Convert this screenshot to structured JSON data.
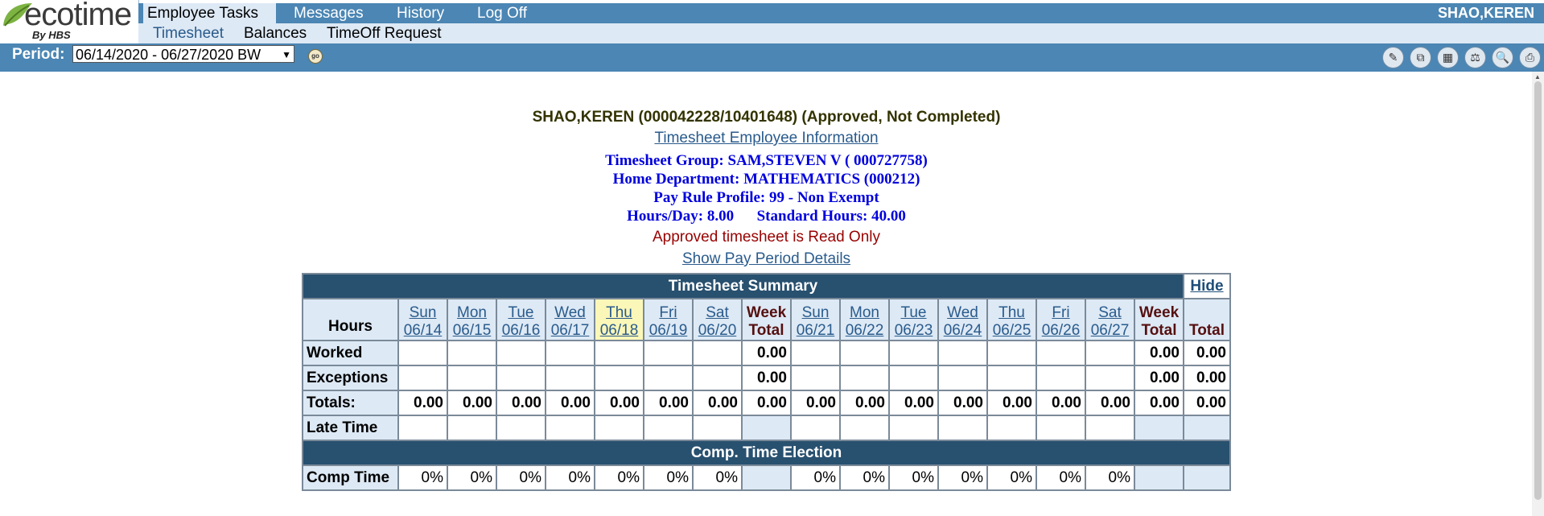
{
  "app": {
    "brand": "ecotime",
    "brand_sub": "By HBS",
    "user": "SHAO,KEREN"
  },
  "topnav": [
    "Employee Tasks",
    "Messages",
    "History",
    "Log Off"
  ],
  "subnav": [
    "Timesheet",
    "Balances",
    "TimeOff Request"
  ],
  "period": {
    "label": "Period:",
    "selected": "06/14/2020 - 06/27/2020 BW",
    "go_label": "go"
  },
  "employee": {
    "title": "SHAO,KEREN (000042228/10401648) (Approved, Not Completed)",
    "info_link": "Timesheet Employee Information",
    "timesheet_group": "Timesheet Group: SAM,STEVEN V ( 000727758)",
    "home_department": "Home Department: MATHEMATICS (000212)",
    "pay_rule": "Pay Rule Profile:   99 - Non Exempt",
    "hours_day": "Hours/Day: 8.00",
    "standard_hours": "Standard Hours: 40.00",
    "readonly_notice": "Approved timesheet is Read Only",
    "show_details": "Show Pay Period Details"
  },
  "summary": {
    "title": "Timesheet Summary",
    "hide": "Hide",
    "hours_label": "Hours",
    "days_week1": [
      {
        "dow": "Sun",
        "date": "06/14"
      },
      {
        "dow": "Mon",
        "date": "06/15"
      },
      {
        "dow": "Tue",
        "date": "06/16"
      },
      {
        "dow": "Wed",
        "date": "06/17"
      },
      {
        "dow": "Thu",
        "date": "06/18"
      },
      {
        "dow": "Fri",
        "date": "06/19"
      },
      {
        "dow": "Sat",
        "date": "06/20"
      }
    ],
    "days_week2": [
      {
        "dow": "Sun",
        "date": "06/21"
      },
      {
        "dow": "Mon",
        "date": "06/22"
      },
      {
        "dow": "Tue",
        "date": "06/23"
      },
      {
        "dow": "Wed",
        "date": "06/24"
      },
      {
        "dow": "Thu",
        "date": "06/25"
      },
      {
        "dow": "Fri",
        "date": "06/26"
      },
      {
        "dow": "Sat",
        "date": "06/27"
      }
    ],
    "week_total_line1": "Week",
    "week_total_line2": "Total",
    "total_label": "Total",
    "rows": {
      "worked": {
        "label": "Worked",
        "week1_total": "0.00",
        "week2_total": "0.00",
        "total": "0.00"
      },
      "exceptions": {
        "label": "Exceptions",
        "week1_total": "0.00",
        "week2_total": "0.00",
        "total": "0.00"
      },
      "totals": {
        "label": "Totals:",
        "value": "0.00"
      },
      "late_time": {
        "label": "Late Time"
      }
    },
    "comp_section": "Comp. Time Election",
    "comp_label": "Comp Time",
    "comp_value": "0%"
  }
}
